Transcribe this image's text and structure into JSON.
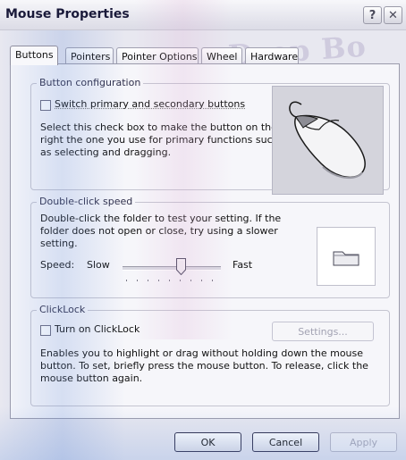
{
  "window": {
    "title": "Mouse Properties",
    "help_label": "?",
    "close_label": "✕",
    "watermark": "Drop Bo"
  },
  "tabs": [
    {
      "label": "Buttons",
      "active": true
    },
    {
      "label": "Pointers",
      "active": false
    },
    {
      "label": "Pointer Options",
      "active": false
    },
    {
      "label": "Wheel",
      "active": false
    },
    {
      "label": "Hardware",
      "active": false
    }
  ],
  "button_config": {
    "group_label": "Button configuration",
    "switch_label": "Switch primary and secondary buttons",
    "switch_checked": false,
    "desc_lines": [
      "Select this check box to make the button on the",
      "right the one you use for primary functions such",
      "as selecting and dragging."
    ]
  },
  "double_click": {
    "group_label": "Double-click speed",
    "desc_lines": [
      "Double-click the folder to test your setting. If the",
      "folder does not open or close, try using a slower",
      "setting."
    ],
    "speed_label": "Speed:",
    "slow_label": "Slow",
    "fast_label": "Fast",
    "speed_value": 0.55
  },
  "clicklock": {
    "group_label": "ClickLock",
    "turn_on_label": "Turn on ClickLock",
    "turn_on_checked": false,
    "settings_label": "Settings...",
    "desc_lines": [
      "Enables you to highlight or drag without holding down the mouse",
      "button. To set, briefly press the mouse button. To release, click the",
      "mouse button again."
    ]
  },
  "footer": {
    "ok_label": "OK",
    "cancel_label": "Cancel",
    "apply_label": "Apply"
  }
}
